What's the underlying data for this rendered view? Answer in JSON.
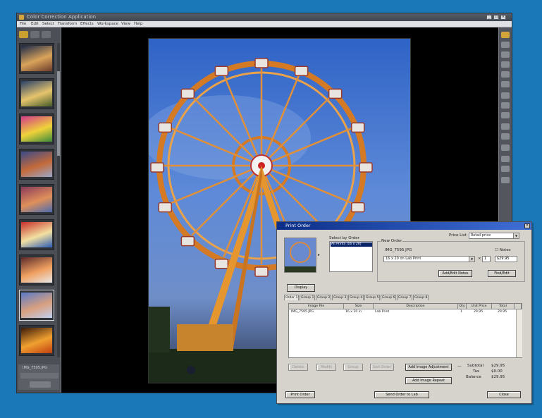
{
  "window": {
    "title": "Color Correction Application",
    "menus": [
      "File",
      "Edit",
      "Select",
      "Transform",
      "Effects",
      "Workspace",
      "View",
      "Help"
    ],
    "controls": [
      "_",
      "□",
      "×"
    ]
  },
  "left_panel": {
    "thumbnails": [
      {
        "name": "thumb-carnival-dusk",
        "colors": [
          "#1c2a4a",
          "#d9a35a",
          "#6b3a2a"
        ]
      },
      {
        "name": "thumb-carnival-ride",
        "colors": [
          "#27406a",
          "#e6c46c",
          "#445a2a"
        ]
      },
      {
        "name": "thumb-bumper-ride",
        "colors": [
          "#d23a8a",
          "#f0d23a",
          "#3a8a3a"
        ]
      },
      {
        "name": "thumb-ferris-wheel",
        "colors": [
          "#3a4a8a",
          "#c46a3a",
          "#9aa8c8"
        ]
      },
      {
        "name": "thumb-carnival-lights",
        "colors": [
          "#8a3a5a",
          "#e0905a",
          "#4a6ab0"
        ]
      },
      {
        "name": "thumb-amusement",
        "colors": [
          "#c8302a",
          "#f2e0a0",
          "#2a5ab8"
        ]
      },
      {
        "name": "thumb-swing-ride",
        "colors": [
          "#5a2a2a",
          "#f0a060",
          "#e8e8e8"
        ]
      },
      {
        "name": "thumb-ferris-selected",
        "colors": [
          "#5a7ac8",
          "#d8a080",
          "#c0d0f0"
        ]
      },
      {
        "name": "thumb-night-ride",
        "colors": [
          "#3a1a0a",
          "#f0a030",
          "#c04010"
        ]
      }
    ],
    "status_text": "IMG_7595.JPG"
  },
  "dialog": {
    "title": "Print Order",
    "select_by_order_label": "Select by Order",
    "order_list": [
      "All Prints (16 x 20)"
    ],
    "new_order_label": "New Order",
    "price_list_label": "Price List",
    "price_list_value": "Retail price",
    "filename": "IMG_7595.JPG",
    "notes_label": "Notes",
    "product_value": "16 x 20 on Lab Print",
    "quantity_value": "1",
    "price_value": "$29.95",
    "add_edit_button": "Add/Edit Notes",
    "find_edit_button": "Find/Edit",
    "display_button": "Display",
    "tabs": [
      "Order 1",
      "Group 1",
      "Group 2",
      "Group 3",
      "Group 4",
      "Group 5",
      "Group 6",
      "Group 7",
      "Group 8"
    ],
    "table": {
      "headers": [
        "Image File",
        "Size",
        "Description",
        "Qty",
        "Unit Price",
        "Total"
      ],
      "rows": [
        [
          "IMG_7595.JPG",
          "16 x 20 in",
          "Lab Print",
          "1",
          "29.95",
          "29.95"
        ]
      ]
    },
    "disabled_buttons": [
      "Delete",
      "Modify",
      "Group",
      "Sort Order"
    ],
    "add_image_adjust_button": "Add Image Adjustment",
    "add_image_repeat_button": "Add Image Repeat",
    "totals": {
      "subtotal_label": "Subtotal",
      "subtotal_value": "$29.95",
      "tax_label": "Tax",
      "tax_value": "$0.00",
      "balance_label": "Balance",
      "balance_value": "$29.95"
    },
    "print_order_button": "Print Order",
    "send_order_button": "Send Order to Lab",
    "close_button": "Close"
  },
  "colors": {
    "desktop": "#1a78b8",
    "dialog_title": "#0b2f88",
    "app_chrome": "#4c5056"
  }
}
